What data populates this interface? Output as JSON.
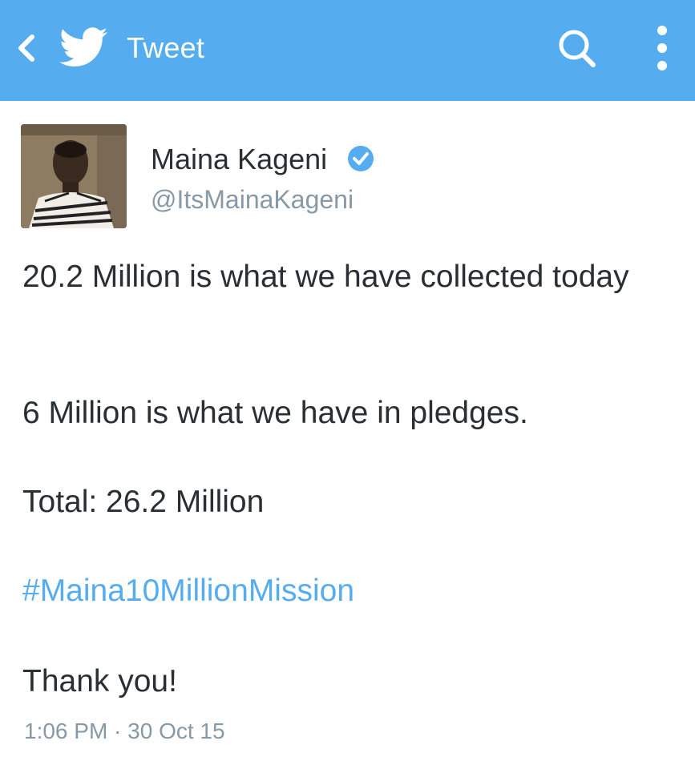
{
  "header": {
    "title": "Tweet",
    "background_color": "#55acee",
    "icons": [
      "back-icon",
      "twitter-bird-icon",
      "search-icon",
      "more-vertical-icon"
    ]
  },
  "tweet": {
    "author_name": "Maina Kageni",
    "author_handle": "@ItsMainaKageni",
    "verified": true,
    "lines": [
      "20.2 Million is what we have collected today",
      "6 Million is what we have in pledges.",
      "Total: 26.2 Million"
    ],
    "hashtag": "#Maina10MillionMission",
    "closing": "Thank you!",
    "timestamp": "1:06 PM · 30 Oct 15",
    "link_color": "#55acee"
  }
}
